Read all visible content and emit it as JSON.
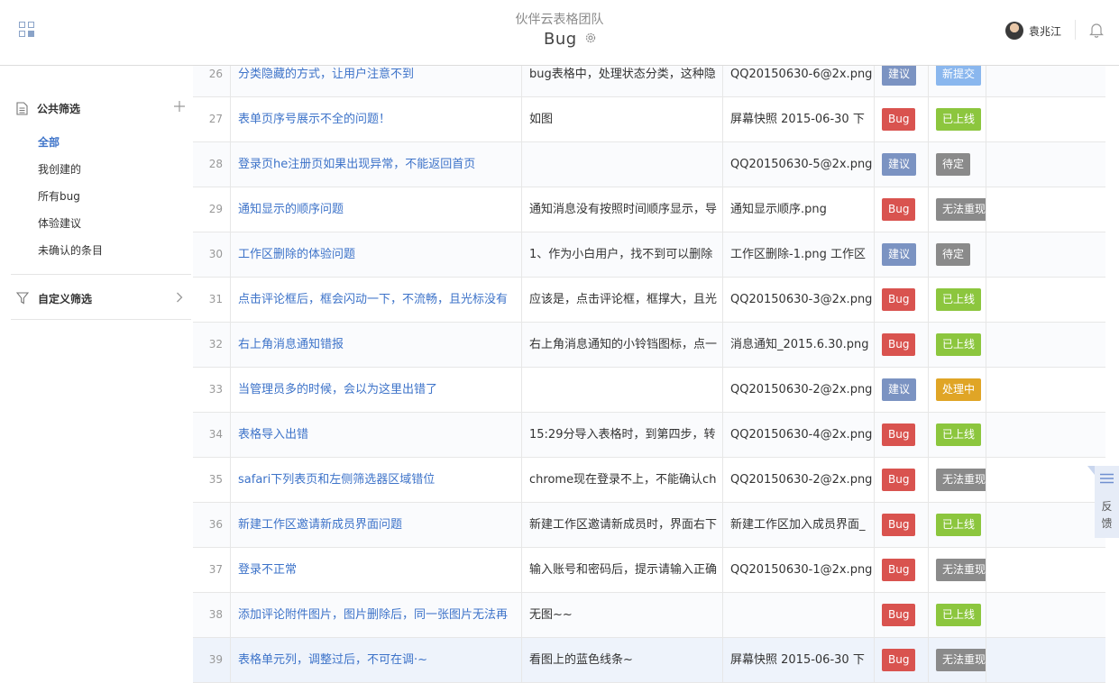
{
  "header": {
    "team": "伙伴云表格团队",
    "title": "Bug",
    "user_name": "袁兆江"
  },
  "sidebar": {
    "public_title": "公共筛选",
    "items": [
      {
        "label": "全部",
        "active": true
      },
      {
        "label": "我创建的",
        "active": false
      },
      {
        "label": "所有bug",
        "active": false
      },
      {
        "label": "体验建议",
        "active": false
      },
      {
        "label": "未确认的条目",
        "active": false
      }
    ],
    "custom_title": "自定义筛选"
  },
  "colors": {
    "bug": "#d9534f",
    "suggestion": "#7b93c2",
    "status_new": "#8ab7ee",
    "status_online": "#8cc63e",
    "status_pending": "#8a8a8a",
    "status_cannot_reproduce": "#8a8a8a",
    "status_processing": "#e0a526",
    "link": "#3d73c9"
  },
  "rows": [
    {
      "num": "26",
      "title": "分类隐藏的方式，让用户注意不到",
      "desc": "bug表格中，处理状态分类，这种隐",
      "attachment": "QQ20150630-6@2x.png",
      "type": "建议",
      "status": "新提交",
      "status_color": "#8ab7ee"
    },
    {
      "num": "27",
      "title": "表单页序号展示不全的问题！",
      "desc": "如图",
      "attachment": "屏幕快照 2015-06-30 下",
      "type": "Bug",
      "status": "已上线",
      "status_color": "#8cc63e"
    },
    {
      "num": "28",
      "title": "登录页he注册页如果出现异常，不能返回首页",
      "desc": "",
      "attachment": "QQ20150630-5@2x.png",
      "type": "建议",
      "status": "待定",
      "status_color": "#8a8a8a"
    },
    {
      "num": "29",
      "title": "通知显示的顺序问题",
      "desc": "通知消息没有按照时间顺序显示，导",
      "attachment": "通知显示顺序.png",
      "type": "Bug",
      "status": "无法重现",
      "status_color": "#8a8a8a"
    },
    {
      "num": "30",
      "title": "工作区删除的体验问题",
      "desc": "1、作为小白用户，找不到可以删除",
      "attachment": "工作区删除-1.png 工作区",
      "type": "建议",
      "status": "待定",
      "status_color": "#8a8a8a"
    },
    {
      "num": "31",
      "title": "点击评论框后，框会闪动一下，不流畅，且光标没有",
      "desc": "应该是，点击评论框，框撑大，且光",
      "attachment": "QQ20150630-3@2x.png",
      "type": "Bug",
      "status": "已上线",
      "status_color": "#8cc63e"
    },
    {
      "num": "32",
      "title": "右上角消息通知错报",
      "desc": "右上角消息通知的小铃铛图标，点一",
      "attachment": "消息通知_2015.6.30.png",
      "type": "Bug",
      "status": "已上线",
      "status_color": "#8cc63e"
    },
    {
      "num": "33",
      "title": "当管理员多的时候，会以为这里出错了",
      "desc": "",
      "attachment": "QQ20150630-2@2x.png",
      "type": "建议",
      "status": "处理中",
      "status_color": "#e0a526"
    },
    {
      "num": "34",
      "title": "表格导入出错",
      "desc": "15:29分导入表格时，到第四步，转",
      "attachment": "QQ20150630-4@2x.png",
      "type": "Bug",
      "status": "已上线",
      "status_color": "#8cc63e"
    },
    {
      "num": "35",
      "title": "safari下列表页和左侧筛选器区域错位",
      "desc": "chrome现在登录不上，不能确认ch",
      "attachment": "QQ20150630-2@2x.png",
      "type": "Bug",
      "status": "无法重现",
      "status_color": "#8a8a8a"
    },
    {
      "num": "36",
      "title": "新建工作区邀请新成员界面问题",
      "desc": "新建工作区邀请新成员时，界面右下",
      "attachment": "新建工作区加入成员界面_",
      "type": "Bug",
      "status": "已上线",
      "status_color": "#8cc63e"
    },
    {
      "num": "37",
      "title": "登录不正常",
      "desc": "输入账号和密码后，提示请输入正确",
      "attachment": "QQ20150630-1@2x.png",
      "type": "Bug",
      "status": "无法重现",
      "status_color": "#8a8a8a"
    },
    {
      "num": "38",
      "title": "添加评论附件图片，图片删除后，同一张图片无法再",
      "desc": "无图~~",
      "attachment": "",
      "type": "Bug",
      "status": "已上线",
      "status_color": "#8cc63e"
    },
    {
      "num": "39",
      "title": "表格单元列，调整过后，不可在调·~",
      "desc": "看图上的蓝色线条~",
      "attachment": "屏幕快照 2015-06-30 下",
      "type": "Bug",
      "status": "无法重现",
      "status_color": "#8a8a8a"
    }
  ],
  "feedback": {
    "label_1": "反",
    "label_2": "馈"
  }
}
